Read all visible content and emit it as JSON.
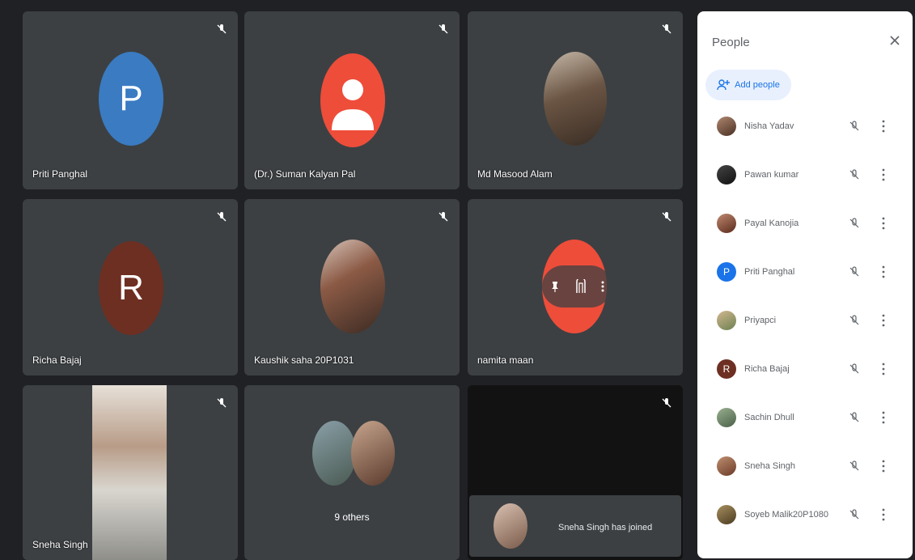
{
  "tiles": [
    {
      "name": "Priti Panghal",
      "initial": "P",
      "color": "#3a7bc2"
    },
    {
      "name": "(Dr.) Suman Kalyan Pal",
      "color": "#ee4d3a"
    },
    {
      "name": "Md Masood Alam"
    },
    {
      "name": "Richa Bajaj",
      "initial": "R",
      "color": "#6d2f22"
    },
    {
      "name": "Kaushik saha 20P1031"
    },
    {
      "name": "namita maan",
      "color": "#ee4d3a"
    },
    {
      "name": "Sneha Singh"
    },
    {
      "name": "9 others"
    }
  ],
  "toast": {
    "message": "Sneha Singh has joined"
  },
  "panel": {
    "title": "People",
    "add_label": "Add people",
    "people": [
      {
        "name": "Nisha Yadav"
      },
      {
        "name": "Pawan kumar"
      },
      {
        "name": "Payal Kanojia"
      },
      {
        "name": "Priti Panghal",
        "initial": "P",
        "color": "#1a73e8"
      },
      {
        "name": "Priyapci"
      },
      {
        "name": "Richa Bajaj",
        "initial": "R",
        "color": "#6d2f22"
      },
      {
        "name": "Sachin Dhull"
      },
      {
        "name": "Sneha Singh"
      },
      {
        "name": "Soyeb Malik20P1080"
      }
    ]
  }
}
